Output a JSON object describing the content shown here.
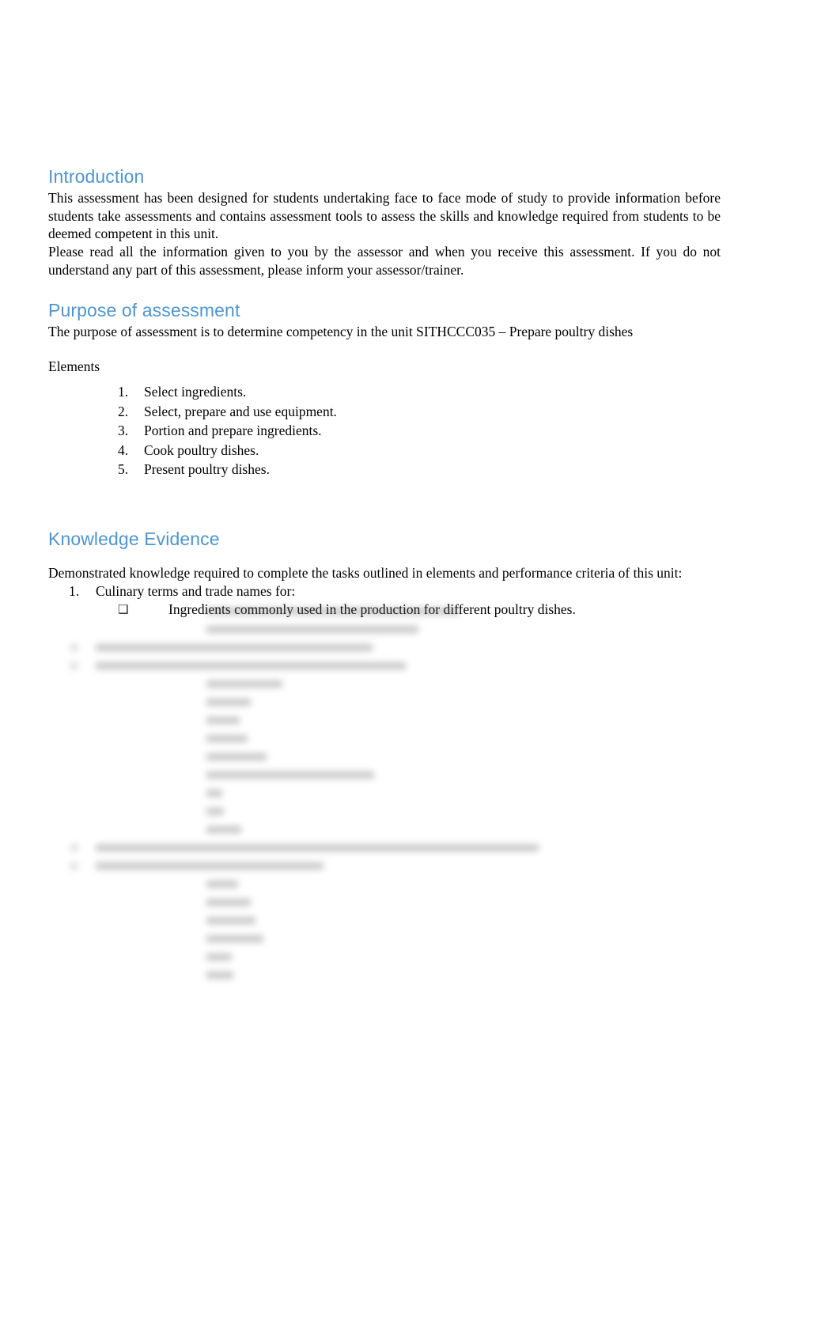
{
  "document": {
    "heading_color": "#4E95D0",
    "body_color": "#000000",
    "background": "#ffffff"
  },
  "introduction": {
    "heading": "Introduction",
    "paragraph_1": "This assessment has been designed for students undertaking face to face mode of study to provide information before students take assessments and contains assessment tools to assess the skills and knowledge required from students to be deemed competent in this unit.",
    "paragraph_2": "Please read all the information given to you by the assessor and when you receive this assessment. If you do not understand any part of this assessment, please inform your assessor/trainer."
  },
  "purpose": {
    "heading": "Purpose of assessment",
    "paragraph": "The purpose of assessment is to determine competency in the unit SITHCCC035 – Prepare poultry dishes",
    "elements_label": "Elements",
    "elements": [
      "Select ingredients.",
      "Select, prepare and use equipment.",
      "Portion and prepare ingredients.",
      "Cook poultry dishes.",
      "Present poultry dishes."
    ]
  },
  "knowledge_evidence": {
    "heading": "Knowledge Evidence",
    "intro": "Demonstrated knowledge required to complete the tasks outlined in elements and performance criteria of this unit:",
    "items": [
      {
        "text": "Culinary terms and trade names for:",
        "bullet_glyph": "❑",
        "sub_items": [
          "Ingredients commonly used in the production for different poultry dishes."
        ]
      }
    ],
    "obscured_note": ""
  }
}
